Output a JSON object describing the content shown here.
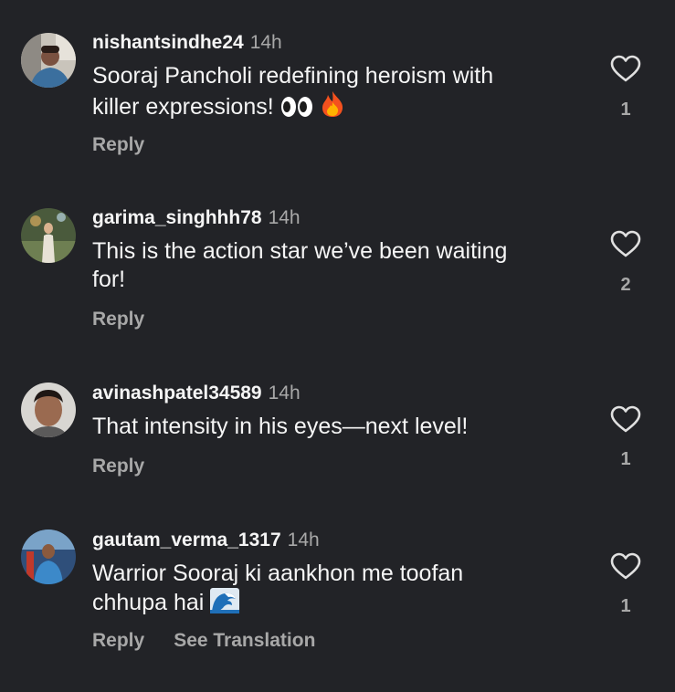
{
  "comments": [
    {
      "username": "nishantsindhe24",
      "time": "14h",
      "text": "Sooraj Pancholi redefining heroism with\nkiller expressions!",
      "emoji": [
        "eyes-emoji",
        "fire-emoji"
      ],
      "actions": [
        "Reply"
      ],
      "likes": "1",
      "avatar": "avatar-photo"
    },
    {
      "username": "garima_singhhh78",
      "time": "14h",
      "text": "This is the action star we’ve been waiting\nfor!",
      "emoji": [],
      "actions": [
        "Reply"
      ],
      "likes": "2",
      "avatar": "avatar-photo"
    },
    {
      "username": "avinashpatel34589",
      "time": "14h",
      "text": "That intensity in his eyes—next level!",
      "emoji": [],
      "actions": [
        "Reply"
      ],
      "likes": "1",
      "avatar": "avatar-photo"
    },
    {
      "username": "gautam_verma_1317",
      "time": "14h",
      "text": "Warrior Sooraj ki aankhon me toofan\nchhupa hai",
      "emoji": [
        "wave-emoji"
      ],
      "actions": [
        "Reply",
        "See Translation"
      ],
      "likes": "1",
      "avatar": "avatar-photo"
    }
  ],
  "colors": {
    "background": "#222327",
    "primary_text": "#f5f5f5",
    "secondary_text": "#a8a8a8"
  }
}
